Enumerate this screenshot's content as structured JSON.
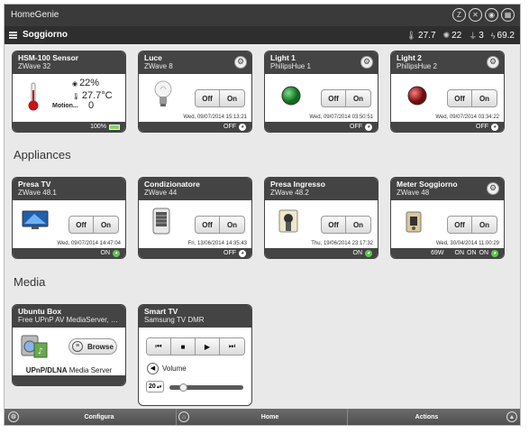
{
  "app": {
    "title": "HomeGenie",
    "top_icons": [
      "zwave-icon",
      "x10-icon",
      "hue-icon",
      "upnp-icon"
    ]
  },
  "subbar": {
    "room": "Soggiorno",
    "stats": {
      "temperature": "27.7",
      "luminance": "22",
      "plugs": "3",
      "power": "69.2"
    }
  },
  "sections": {
    "appliances": "Appliances",
    "media": "Media"
  },
  "cards": {
    "hsm": {
      "name": "HSM-100 Sensor",
      "sub": "ZWave 32",
      "humidity": "22%",
      "temp": "27.7°C",
      "motion_label": "Motion...",
      "motion_value": "0",
      "battery": "100%"
    },
    "luce": {
      "name": "Luce",
      "sub": "ZWave 8",
      "off": "Off",
      "on": "On",
      "date": "Wed, 09/07/2014 15:13:21",
      "status": "OFF"
    },
    "light1": {
      "name": "Light 1",
      "sub": "PhilipsHue 1",
      "off": "Off",
      "on": "On",
      "date": "Wed, 09/07/2014 03:50:51",
      "status": "OFF"
    },
    "light2": {
      "name": "Light 2",
      "sub": "PhilipsHue 2",
      "off": "Off",
      "on": "On",
      "date": "Wed, 09/07/2014 03:34:22",
      "status": "OFF"
    },
    "presatv": {
      "name": "Presa TV",
      "sub": "ZWave 48.1",
      "off": "Off",
      "on": "On",
      "date": "Wed, 09/07/2014 14:47:04",
      "status": "ON"
    },
    "condiz": {
      "name": "Condizionatore",
      "sub": "ZWave 44",
      "off": "Off",
      "on": "On",
      "date": "Fri, 13/06/2014 14:35:43",
      "status": "OFF"
    },
    "presain": {
      "name": "Presa Ingresso",
      "sub": "ZWave 48.2",
      "off": "Off",
      "on": "On",
      "date": "Thu, 19/06/2014 23:17:32",
      "status": "ON"
    },
    "meter": {
      "name": "Meter Soggiorno",
      "sub": "ZWave 48",
      "off": "Off",
      "on": "On",
      "date": "Wed, 30/04/2014 11:00:29",
      "watt": "69W",
      "status1": "ON",
      "status2": "ON",
      "status3": "ON"
    },
    "ubuntu": {
      "name": "Ubuntu Box",
      "sub": "Free UPnP AV MediaServer, GNU...",
      "browse": "Browse",
      "label_bold": "UPnP/DLNA",
      "label_rest": " Media Server"
    },
    "smarttv": {
      "name": "Smart TV",
      "sub": "Samsung TV DMR",
      "volume_label": "Volume",
      "volume_value": "20",
      "volume_level": 0.15
    }
  },
  "bottombar": {
    "left": "Configura",
    "center": "Home",
    "right": "Actions"
  },
  "colors": {
    "header": "#444444",
    "on_green": "#61c451",
    "red_bulb": "#b22222",
    "green_bulb": "#1a8f2a"
  }
}
